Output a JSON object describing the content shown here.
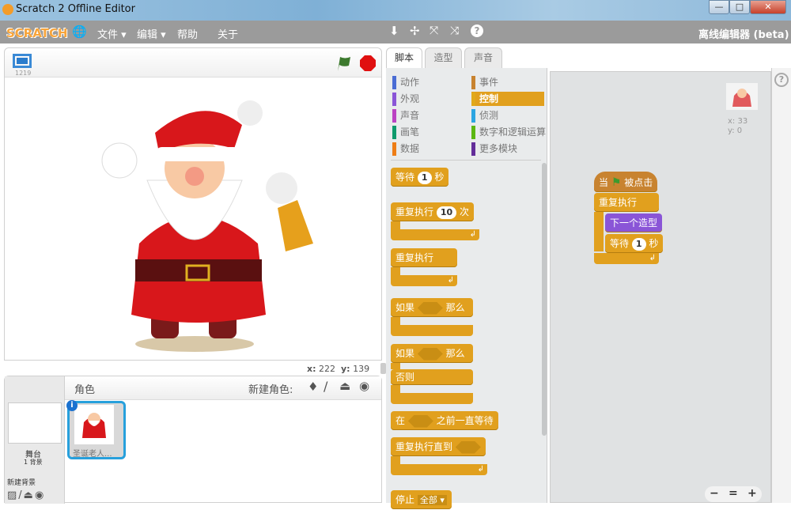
{
  "window": {
    "title": "Scratch 2 Offline Editor",
    "controls": [
      "—",
      "□",
      "✕"
    ]
  },
  "menubar": {
    "logo": "SCRATCH",
    "items": [
      "文件 ▾",
      "编辑 ▾",
      "帮助",
      "关于"
    ],
    "right_label": "离线编辑器 (beta)"
  },
  "stage": {
    "version": "1219",
    "mouse_x_label": "x:",
    "mouse_x": "222",
    "mouse_y_label": "y:",
    "mouse_y": "139"
  },
  "tabs": [
    "脚本",
    "造型",
    "声音"
  ],
  "categories": {
    "left": [
      {
        "label": "动作",
        "color": "#4a6cd4"
      },
      {
        "label": "外观",
        "color": "#8a55d7"
      },
      {
        "label": "声音",
        "color": "#bb42c3"
      },
      {
        "label": "画笔",
        "color": "#0e9a6c"
      },
      {
        "label": "数据",
        "color": "#ee7d16"
      }
    ],
    "right": [
      {
        "label": "事件",
        "color": "#c88330"
      },
      {
        "label": "控制",
        "color": "#e1a91a",
        "selected": true
      },
      {
        "label": "侦测",
        "color": "#2ca5e2"
      },
      {
        "label": "数字和逻辑运算",
        "color": "#5cb712"
      },
      {
        "label": "更多模块",
        "color": "#632d99"
      }
    ]
  },
  "palette": {
    "wait": "等待",
    "wait_val": "1",
    "wait_unit": "秒",
    "repeat": "重复执行",
    "repeat_val": "10",
    "repeat_unit": "次",
    "forever": "重复执行",
    "if": "如果",
    "then": "那么",
    "if2": "如果",
    "then2": "那么",
    "else": "否则",
    "wait_until_pre": "在",
    "wait_until_post": "之前一直等待",
    "repeat_until": "重复执行直到",
    "stop": "停止",
    "stop_val": "全部 ▾"
  },
  "script": {
    "hat_pre": "当",
    "hat_post": "被点击",
    "forever": "重复执行",
    "next_costume": "下一个造型",
    "wait": "等待",
    "wait_val": "1",
    "wait_unit": "秒"
  },
  "sprite_info": {
    "x": "x: 33",
    "y": "y: 0"
  },
  "sprites": {
    "header": "角色",
    "new_sprite": "新建角色:",
    "stage_label": "舞台",
    "backdrops": "1 背景",
    "new_backdrop": "新建背景",
    "items": [
      {
        "name": "圣诞老人..."
      }
    ]
  },
  "zoom": {
    "out": "−",
    "reset": "=",
    "in": "+"
  }
}
